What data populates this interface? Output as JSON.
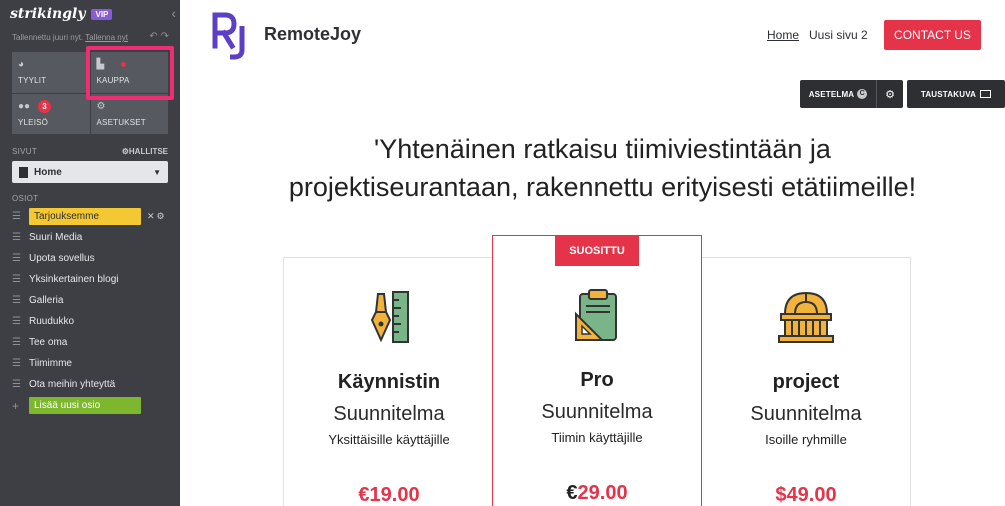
{
  "sidebar": {
    "logo": "strikingly",
    "vip": "VIP",
    "saved_text": "Tallennettu juuri nyt.",
    "save_link": "Tallenna nyt",
    "tiles": [
      {
        "label": "TYYLIT",
        "icon": "palette-icon"
      },
      {
        "label": "KAUPPA",
        "icon": "bag-icon"
      },
      {
        "label": "YLEISÖ",
        "icon": "users-icon",
        "badge": "3"
      },
      {
        "label": "ASETUKSET",
        "icon": "gear-icon"
      }
    ],
    "pages_label": "SIVUT",
    "manage_label": "HALLITSE",
    "current_page": "Home",
    "sections_label": "OSIOT",
    "sections": [
      "Tarjouksemme",
      "Suuri Media",
      "Upota sovellus",
      "Yksinkertainen blogi",
      "Galleria",
      "Ruudukko",
      "Tee oma",
      "Tiimimme",
      "Ota meihin yhteyttä"
    ],
    "add_section": "Lisää uusi osio"
  },
  "site": {
    "name": "RemoteJoy",
    "nav": [
      "Home",
      "Uusi sivu 2"
    ],
    "contact": "CONTACT US",
    "layout_button": "ASETELMA",
    "layout_badge": "C",
    "background_button": "TAUSTAKUVA",
    "headline_line1": "'Yhtenäinen ratkaisu tiimiviestintään ja",
    "headline_line2": "projektiseurantaan, rakennettu erityisesti etätiimeille!",
    "colors": {
      "accent": "#e5344a",
      "brand_purple": "#5b3fc4",
      "sidebar": "#3d3f45"
    }
  },
  "plans": [
    {
      "title": "Käynnistin",
      "subtitle": "Suunnitelma",
      "desc": "Yksittäisille käyttäjille",
      "currency": "€",
      "price": "19.00",
      "icon": "pen-ruler-icon"
    },
    {
      "title": "Pro",
      "subtitle": "Suunnitelma",
      "desc": "Tiimin käyttäjille",
      "currency": "€",
      "price": "29.00",
      "ribbon": "SUOSITTU",
      "icon": "clipboard-icon"
    },
    {
      "title": "project",
      "subtitle": "Suunnitelma",
      "desc": "Isoille ryhmille",
      "currency": "$",
      "price": "49.00",
      "icon": "building-icon"
    }
  ]
}
